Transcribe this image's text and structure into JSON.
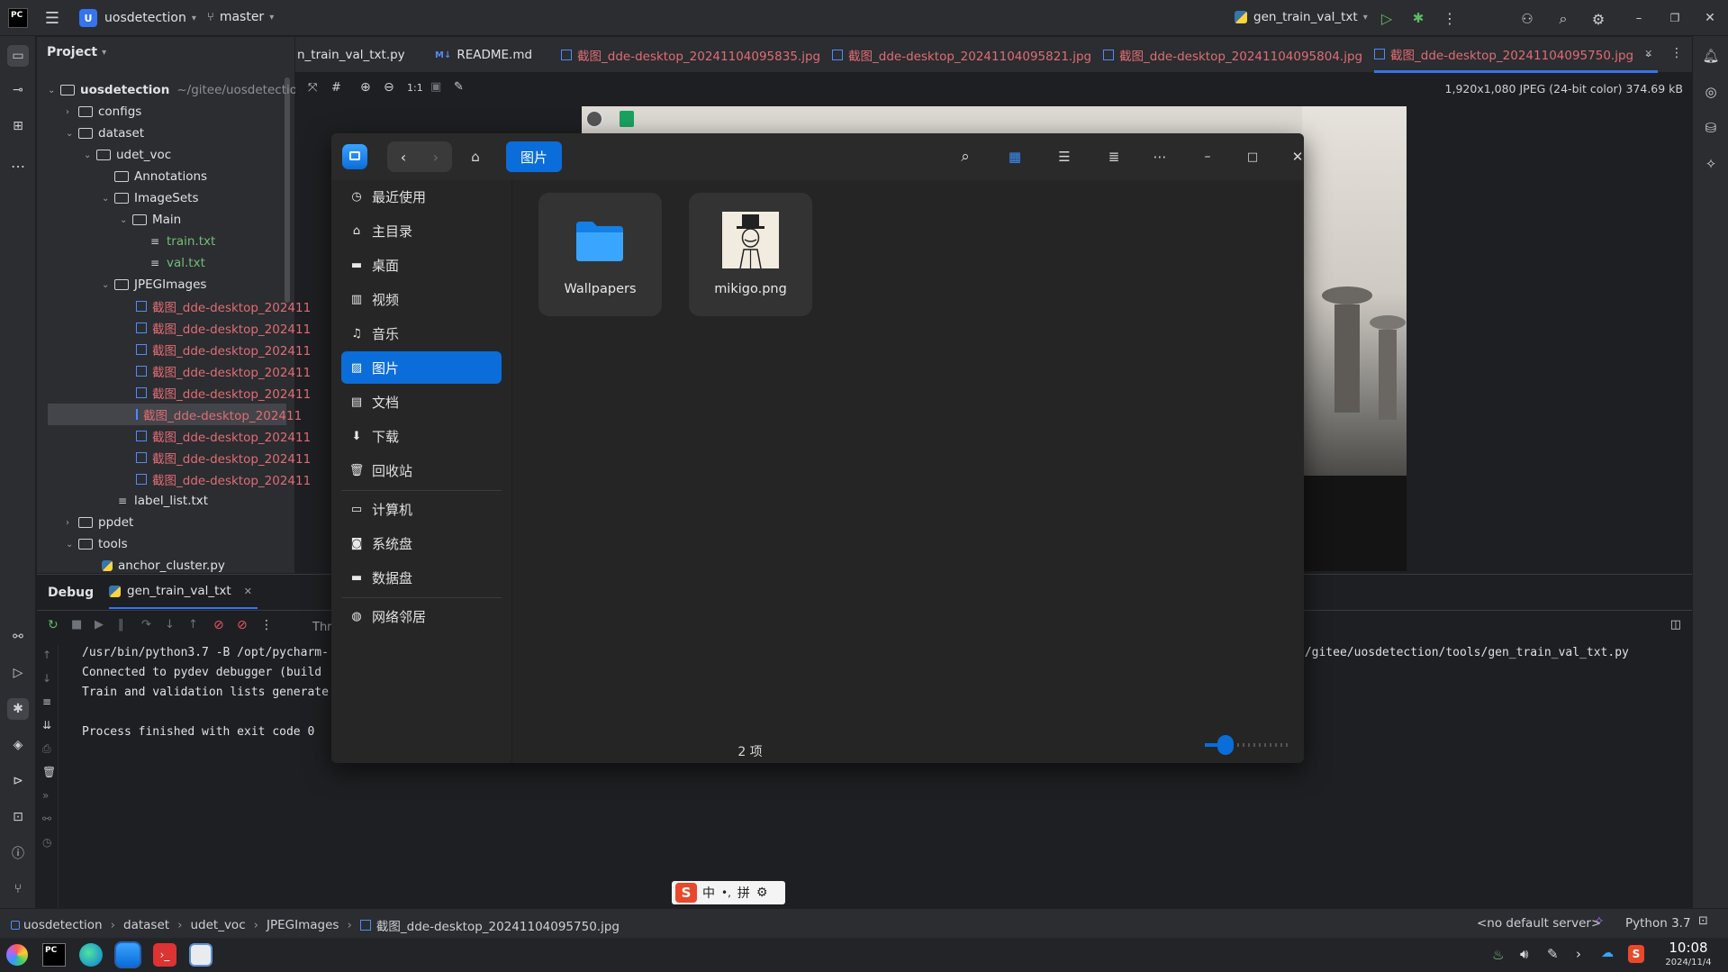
{
  "titlebar": {
    "project_badge": "U",
    "project_name": "uosdetection",
    "branch": "master",
    "run_config": "gen_train_val_txt"
  },
  "project_panel": {
    "title": "Project",
    "root_name": "uosdetection",
    "root_path": "~/gitee/uosdetection",
    "rows": [
      {
        "label": "configs"
      },
      {
        "label": "dataset"
      },
      {
        "label": "udet_voc"
      },
      {
        "label": "Annotations"
      },
      {
        "label": "ImageSets"
      },
      {
        "label": "Main"
      },
      {
        "label": "train.txt"
      },
      {
        "label": "val.txt"
      },
      {
        "label": "JPEGImages"
      },
      {
        "label": "截图_dde-desktop_202411"
      },
      {
        "label": "截图_dde-desktop_202411"
      },
      {
        "label": "截图_dde-desktop_202411"
      },
      {
        "label": "截图_dde-desktop_202411"
      },
      {
        "label": "截图_dde-desktop_202411"
      },
      {
        "label": "截图_dde-desktop_202411"
      },
      {
        "label": "截图_dde-desktop_202411"
      },
      {
        "label": "截图_dde-desktop_202411"
      },
      {
        "label": "截图_dde-desktop_202411"
      },
      {
        "label": "label_list.txt"
      },
      {
        "label": "ppdet"
      },
      {
        "label": "tools"
      },
      {
        "label": "anchor_cluster.py"
      }
    ]
  },
  "editor_tabs": [
    {
      "label": "n_train_val_txt.py"
    },
    {
      "label": "README.md",
      "prefix": "M↓"
    },
    {
      "label": "截图_dde-desktop_20241104095835.jpg"
    },
    {
      "label": "截图_dde-desktop_20241104095821.jpg"
    },
    {
      "label": "截图_dde-desktop_20241104095804.jpg"
    },
    {
      "label": "截图_dde-desktop_20241104095750.jpg"
    }
  ],
  "image_toolbar": {
    "zoom_label": "1:1",
    "image_info": "1,920x1,080 JPEG (24-bit color) 374.69 kB"
  },
  "debug": {
    "title": "Debug",
    "session_tab": "gen_train_val_txt",
    "threads_label": "Thr",
    "console": [
      "/usr/bin/python3.7 -B /opt/pycharm-",
      "Connected to pydev debugger (build",
      "Train and validation lists generate",
      "",
      "Process finished with exit code 0"
    ],
    "console_right": "o/gitee/uosdetection/tools/gen_train_val_txt.py"
  },
  "file_manager": {
    "location_button": "图片",
    "sidebar": [
      {
        "label": "最近使用",
        "icon": "clock-icon"
      },
      {
        "label": "主目录",
        "icon": "home-icon"
      },
      {
        "label": "桌面",
        "icon": "desktop-icon"
      },
      {
        "label": "视频",
        "icon": "video-icon"
      },
      {
        "label": "音乐",
        "icon": "music-icon"
      },
      {
        "label": "图片",
        "icon": "picture-icon",
        "active": true
      },
      {
        "label": "文档",
        "icon": "document-icon"
      },
      {
        "label": "下载",
        "icon": "download-icon"
      },
      {
        "label": "回收站",
        "icon": "trash-icon"
      },
      {
        "label": "计算机",
        "icon": "computer-icon"
      },
      {
        "label": "系统盘",
        "icon": "disk-icon"
      },
      {
        "label": "数据盘",
        "icon": "disk-icon"
      },
      {
        "label": "网络邻居",
        "icon": "network-icon"
      }
    ],
    "items": [
      {
        "label": "Wallpapers",
        "type": "folder"
      },
      {
        "label": "mikigo.png",
        "type": "image"
      }
    ],
    "item_count": "2 项",
    "zoom_slider_level": 0.25
  },
  "ime_bar": {
    "mode": "中",
    "punct": "•,",
    "input": "拼"
  },
  "statusbar": {
    "breadcrumb": [
      "uosdetection",
      "dataset",
      "udet_voc",
      "JPEGImages",
      "截图_dde-desktop_20241104095750.jpg"
    ],
    "server": "<no default server>",
    "interpreter": "Python 3.7"
  },
  "taskbar": {
    "time": "10:08",
    "date": "2024/11/4"
  },
  "colors": {
    "accent": "#3574f0",
    "fm_accent": "#0a6dd9",
    "modified_file": "#e06c75",
    "new_file": "#73bd79"
  }
}
